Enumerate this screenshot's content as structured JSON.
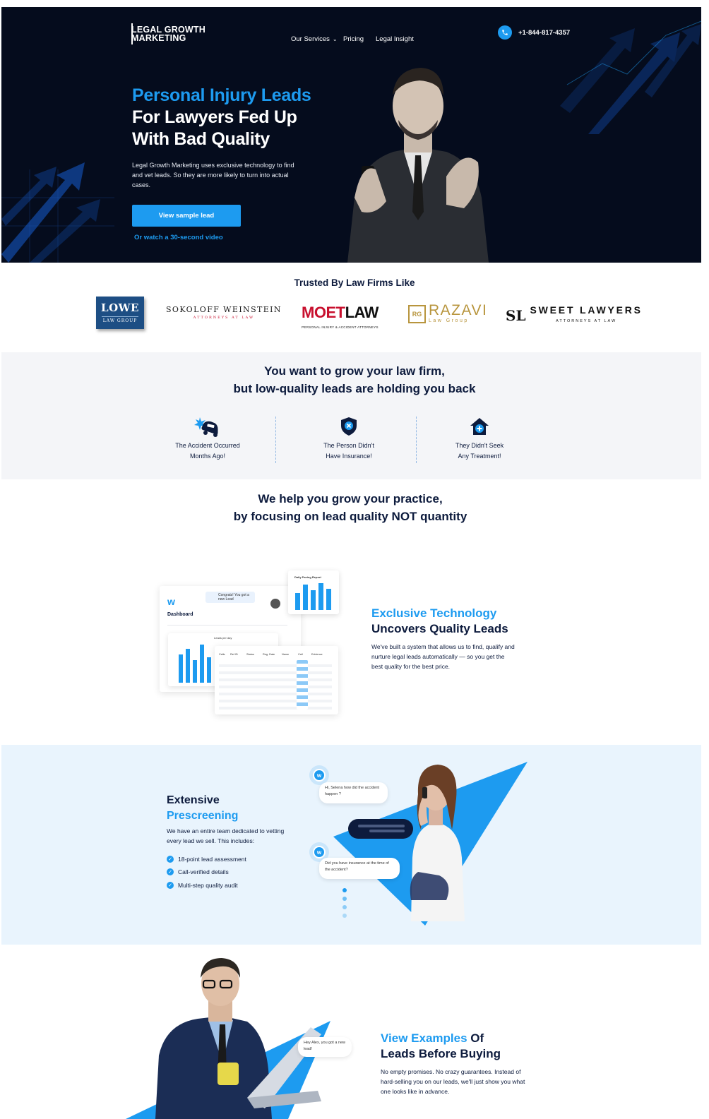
{
  "header": {
    "logo_line1": "LEGAL GROWTH",
    "logo_line2": "MARKETING",
    "nav": {
      "services": "Our Services",
      "pricing": "Pricing",
      "insight": "Legal Insight"
    },
    "phone": "+1-844-817-4357"
  },
  "hero": {
    "title_accent": "Personal Injury Leads",
    "title_line2": "For Lawyers Fed Up",
    "title_line3": "With Bad Quality",
    "description": "Legal Growth Marketing uses exclusive technology to find and vet leads. So they are more likely to turn into actual cases.",
    "cta": "View sample lead",
    "video_link": "Or watch a 30-second video"
  },
  "trusted": {
    "title": "Trusted By Law Firms Like",
    "logos": {
      "lowe": "LOWE",
      "lowe_sub": "LAW GROUP",
      "sokoloff": "SOKOLOFF WEINSTEIN",
      "sokoloff_sub": "ATTORNEYS AT LAW",
      "moet_red": "MOET",
      "moet_black": "LAW",
      "moet_sub": "PERSONAL INJURY & ACCIDENT ATTORNEYS",
      "razavi": "RAZAVI",
      "razavi_sub": "Law Group",
      "sweet": "SWEET LAWYERS",
      "sweet_sub": "ATTORNEYS AT LAW"
    }
  },
  "problem": {
    "title_line1": "You want to grow your law firm,",
    "title_line2": "but low-quality leads are holding you back",
    "items": [
      {
        "line1": "The Accident Occurred",
        "line2": "Months Ago!",
        "icon": "car-crash-icon"
      },
      {
        "line1": "The Person Didn't",
        "line2": "Have Insurance!",
        "icon": "shield-x-icon"
      },
      {
        "line1": "They Didn't Seek",
        "line2": "Any Treatment!",
        "icon": "medical-house-icon"
      }
    ]
  },
  "help": {
    "title_line1": "We help you grow your practice,",
    "title_line2": "by focusing on lead quality NOT quantity"
  },
  "dashboard": {
    "title": "Dashboard",
    "notification": "Congrats! You got a new Lead",
    "leads_per_day": "Leads per day",
    "report_title": "Daily Pacing Report",
    "table_headers": [
      "Calls",
      "Ref ID",
      "Status",
      "Reg. Date",
      "Name",
      "Call",
      "Evidence"
    ]
  },
  "technology": {
    "title_accent": "Exclusive Technology",
    "title_dark": "Uncovers Quality Leads",
    "description": "We've built a system that allows us to find, qualify and nurture legal leads automatically — so you get the best quality for the best price."
  },
  "prescreening": {
    "title_dark": "Extensive",
    "title_accent": "Prescreening",
    "description": "We have an entire team dedicated to vetting every lead we sell. This includes:",
    "checks": [
      "18-point lead assessment",
      "Call-verified details",
      "Multi-step quality audit"
    ],
    "bubble1": "Hi, Selena how did the accident happen ?",
    "bubble2": "Did you have insurance at the time of the accident?"
  },
  "examples": {
    "title_accent": "View Examples",
    "title_of": " Of",
    "title_line2": "Leads Before Buying",
    "description": "No empty promises. No crazy guarantees. Instead of hard-selling you on our leads, we'll just show you what one looks like in advance.",
    "bubble": "Hey Alex, you got a new lead!"
  },
  "colors": {
    "accent": "#1d9bf0",
    "navy": "#0d1b3d",
    "hero_bg": "#050c1d"
  }
}
